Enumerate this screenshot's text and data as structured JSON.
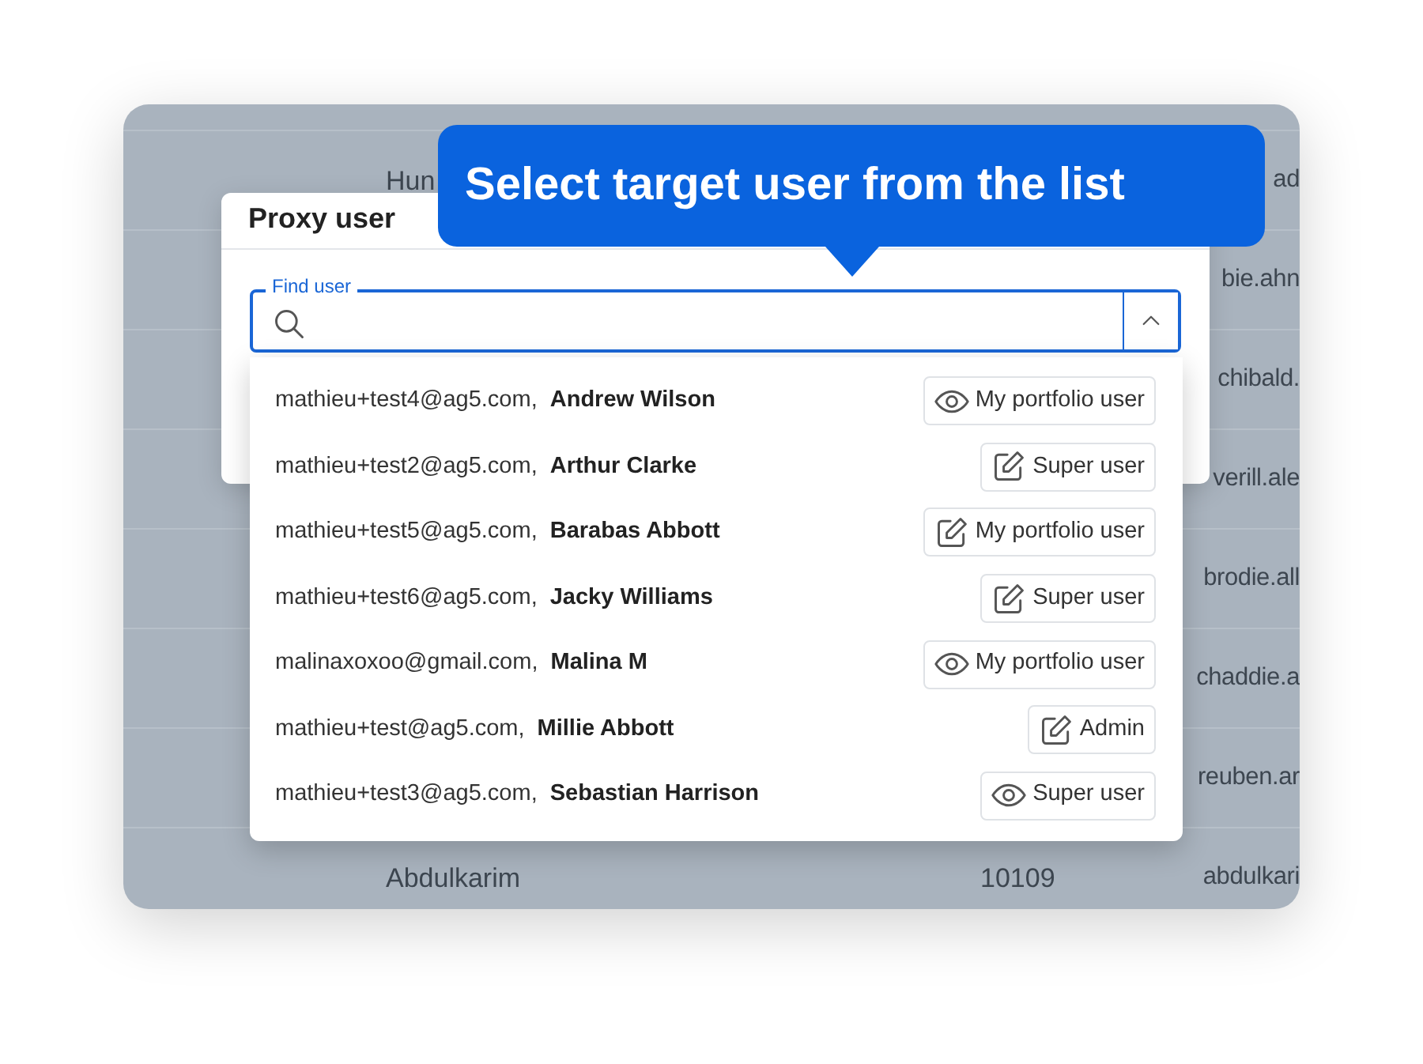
{
  "background_table": {
    "rows": [
      {
        "column_1": "Hun",
        "column_3": "ad"
      },
      {
        "column_3": "bie.ahn"
      },
      {
        "column_3": "chibald."
      },
      {
        "column_3": "verill.ale"
      },
      {
        "column_3": "brodie.all"
      },
      {
        "column_3": "chaddie.a"
      },
      {
        "column_3": "reuben.ar"
      },
      {
        "column_1": "Abdulkarim",
        "column_2": "10109",
        "column_3": "abdulkari"
      }
    ]
  },
  "dialog": {
    "title": "Proxy user",
    "field": {
      "label": "Find user",
      "expanded": true
    }
  },
  "dropdown": {
    "items": [
      {
        "email": "mathieu+test4@ag5.com,",
        "name": "Andrew Wilson",
        "role": {
          "kind": "view",
          "label": "My portfolio user"
        }
      },
      {
        "email": "mathieu+test2@ag5.com,",
        "name": "Arthur Clarke",
        "role": {
          "kind": "edit",
          "label": "Super user"
        }
      },
      {
        "email": "mathieu+test5@ag5.com,",
        "name": "Barabas Abbott",
        "role": {
          "kind": "edit",
          "label": "My portfolio user"
        }
      },
      {
        "email": "mathieu+test6@ag5.com,",
        "name": "Jacky Williams",
        "role": {
          "kind": "edit",
          "label": "Super user"
        }
      },
      {
        "email": "malinaxoxoo@gmail.com,",
        "name": "Malina M",
        "role": {
          "kind": "view",
          "label": "My portfolio user"
        }
      },
      {
        "email": "mathieu+test@ag5.com,",
        "name": "Millie Abbott",
        "role": {
          "kind": "edit",
          "label": "Admin"
        }
      },
      {
        "email": "mathieu+test3@ag5.com,",
        "name": "Sebastian Harrison",
        "role": {
          "kind": "view",
          "label": "Super user"
        }
      }
    ]
  },
  "tooltip": {
    "text": "Select target user from the list"
  }
}
